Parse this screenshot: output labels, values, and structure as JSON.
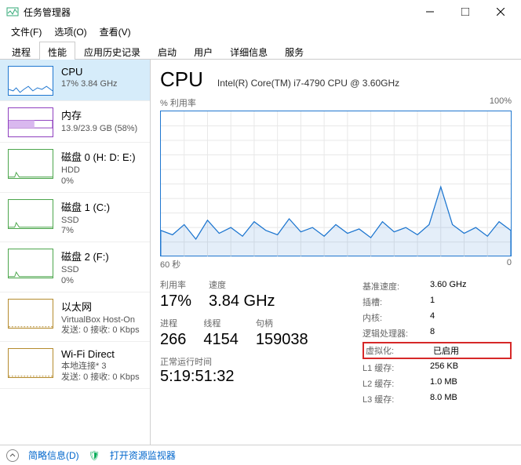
{
  "window": {
    "title": "任务管理器"
  },
  "menu": {
    "file": "文件(F)",
    "options": "选项(O)",
    "view": "查看(V)"
  },
  "tabs": [
    "进程",
    "性能",
    "应用历史记录",
    "启动",
    "用户",
    "详细信息",
    "服务"
  ],
  "active_tab": 1,
  "sidebar": [
    {
      "name": "CPU",
      "line2": "17% 3.84 GHz",
      "kind": "cpu",
      "selected": true
    },
    {
      "name": "内存",
      "line2": "13.9/23.9 GB (58%)",
      "kind": "mem"
    },
    {
      "name": "磁盘 0 (H: D: E:)",
      "line2": "HDD",
      "line3": "0%",
      "kind": "disk"
    },
    {
      "name": "磁盘 1 (C:)",
      "line2": "SSD",
      "line3": "7%",
      "kind": "disk"
    },
    {
      "name": "磁盘 2 (F:)",
      "line2": "SSD",
      "line3": "0%",
      "kind": "disk"
    },
    {
      "name": "以太网",
      "line2": "VirtualBox Host-On",
      "line3": "发送: 0 接收: 0 Kbps",
      "kind": "eth"
    },
    {
      "name": "Wi-Fi Direct",
      "line2": "本地连接* 3",
      "line3": "发送: 0 接收: 0 Kbps",
      "kind": "eth"
    }
  ],
  "main": {
    "title": "CPU",
    "subtitle": "Intel(R) Core(TM) i7-4790 CPU @ 3.60GHz",
    "chart_top_left": "% 利用率",
    "chart_top_right": "100%",
    "chart_bot_left": "60 秒",
    "chart_bot_right": "0",
    "stats1": [
      {
        "lbl": "利用率",
        "val": "17%"
      },
      {
        "lbl": "速度",
        "val": "3.84 GHz"
      }
    ],
    "stats2": [
      {
        "lbl": "进程",
        "val": "266"
      },
      {
        "lbl": "线程",
        "val": "4154"
      },
      {
        "lbl": "句柄",
        "val": "159038"
      }
    ],
    "uptime_lbl": "正常运行时间",
    "uptime_val": "5:19:51:32",
    "right": [
      {
        "k": "基准速度:",
        "v": "3.60 GHz"
      },
      {
        "k": "插槽:",
        "v": "1"
      },
      {
        "k": "内核:",
        "v": "4"
      },
      {
        "k": "逻辑处理器:",
        "v": "8"
      },
      {
        "k": "虚拟化:",
        "v": "已启用",
        "hl": true
      },
      {
        "k": "L1 缓存:",
        "v": "256 KB"
      },
      {
        "k": "L2 缓存:",
        "v": "1.0 MB"
      },
      {
        "k": "L3 缓存:",
        "v": "8.0 MB"
      }
    ]
  },
  "footer": {
    "brief": "简略信息(D)",
    "monitor": "打开资源监视器"
  },
  "chart_data": {
    "type": "line",
    "title": "% 利用率",
    "xlabel": "60 秒",
    "ylabel": "",
    "ylim": [
      0,
      100
    ],
    "x": [
      0,
      2,
      4,
      6,
      8,
      10,
      12,
      14,
      16,
      18,
      20,
      22,
      24,
      26,
      28,
      30,
      32,
      34,
      36,
      38,
      40,
      42,
      44,
      46,
      48,
      50,
      52,
      54,
      56,
      58,
      60
    ],
    "values": [
      18,
      15,
      22,
      12,
      25,
      16,
      20,
      14,
      24,
      18,
      15,
      26,
      17,
      20,
      14,
      22,
      16,
      19,
      13,
      24,
      17,
      20,
      15,
      22,
      48,
      22,
      16,
      20,
      14,
      24,
      18
    ]
  }
}
